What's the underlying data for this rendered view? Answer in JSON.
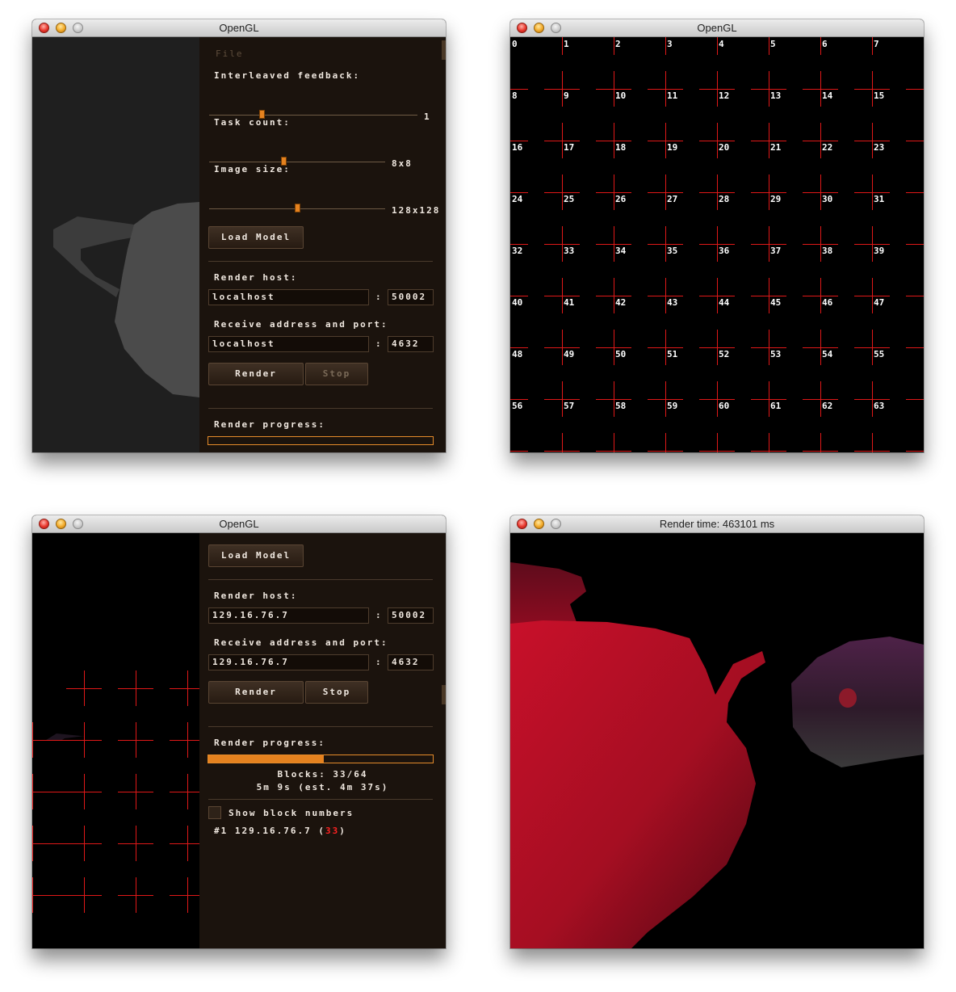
{
  "windows": {
    "w1": {
      "title": "OpenGL",
      "menu": "File",
      "interleaved_label": "Interleaved feedback:",
      "interleaved_value": "1",
      "interleaved_level": 0.25,
      "task_label": "Task count:",
      "task_value": "8x8",
      "task_level": 0.42,
      "image_label": "Image size:",
      "image_value": "128x128",
      "image_level": 0.5,
      "load_model": "Load Model",
      "render_host_label": "Render host:",
      "render_host": "localhost",
      "render_port": "50002",
      "receive_label": "Receive address and port:",
      "receive_host": "localhost",
      "receive_port": "4632",
      "render_btn": "Render",
      "stop_btn": "Stop",
      "progress_label": "Render progress:",
      "progress": 0,
      "colon": ":"
    },
    "w2": {
      "title": "OpenGL",
      "block_numbers": [
        "0",
        "1",
        "2",
        "3",
        "4",
        "5",
        "6",
        "7",
        "8",
        "9",
        "10",
        "11",
        "12",
        "13",
        "14",
        "15",
        "16",
        "17",
        "18",
        "19",
        "20",
        "21",
        "22",
        "23",
        "24",
        "25",
        "26",
        "27",
        "28",
        "29",
        "30",
        "31",
        "32",
        "33",
        "34",
        "35",
        "36",
        "37",
        "38",
        "39",
        "40",
        "41",
        "42",
        "43",
        "44",
        "45",
        "46",
        "47",
        "48",
        "49",
        "50",
        "51",
        "52",
        "53",
        "54",
        "55",
        "56",
        "57",
        "58",
        "59",
        "60",
        "61",
        "62",
        "63"
      ]
    },
    "w3": {
      "title": "OpenGL",
      "load_model": "Load Model",
      "render_host_label": "Render host:",
      "render_host": "129.16.76.7",
      "render_port": "50002",
      "receive_label": "Receive address and port:",
      "receive_host": "129.16.76.7",
      "receive_port": "4632",
      "render_btn": "Render",
      "stop_btn": "Stop",
      "progress_label": "Render progress:",
      "progress": 0.515,
      "blocks_text": "Blocks: 33/64",
      "time_text": "5m 9s (est. 4m 37s)",
      "show_block_numbers": "Show block numbers",
      "worker_prefix": "#1 129.16.76.7 (",
      "worker_count": "33",
      "worker_suffix": ")",
      "colon": ":"
    },
    "w4": {
      "title": "Render time: 463101 ms"
    }
  },
  "colors": {
    "accent": "#e5821f",
    "panel_bg": "#1b130d",
    "grid_line": "#e01818",
    "teapot_red": "#b0101f",
    "teapot_purple": "#4a2040"
  },
  "icons": [
    "close-light-icon",
    "minimize-light-icon",
    "zoom-light-icon"
  ]
}
